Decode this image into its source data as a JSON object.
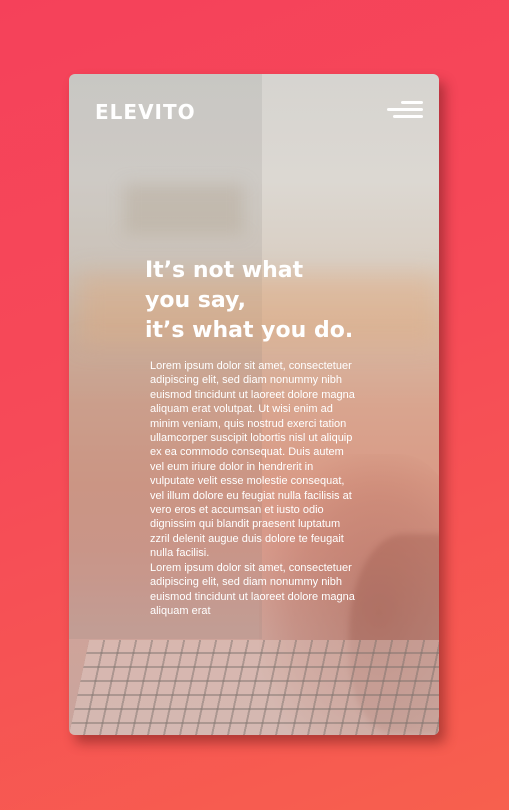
{
  "app": {
    "logo_text": "ELEVITO"
  },
  "header": {
    "menu_icon": "hamburger-menu-icon"
  },
  "hero": {
    "headline_lines": [
      "It’s not what",
      "you say,",
      "it’s what you do."
    ],
    "paragraphs": [
      "Lorem ipsum dolor sit amet, consectetuer adipiscing elit, sed diam nonummy nibh euismod tincidunt ut laoreet dolore magna aliquam erat volutpat. Ut wisi enim ad minim veniam, quis nostrud exerci tation ullamcorper suscipit lobortis nisl ut aliquip ex ea commodo consequat. Duis autem vel eum iriure dolor in hendrerit in vulputate velit esse molestie consequat, vel illum dolore eu feugiat nulla facilisis at vero eros et accumsan et iusto odio dignissim qui blandit praesent luptatum zzril delenit augue duis dolore te feugait nulla facilisi.",
      "Lorem ipsum dolor sit amet, consectetuer adipiscing elit, sed diam nonummy nibh euismod tincidunt ut laoreet dolore magna aliquam erat"
    ]
  },
  "colors": {
    "background_start": "#f5415a",
    "background_end": "#f7604e",
    "text": "#ffffff"
  }
}
